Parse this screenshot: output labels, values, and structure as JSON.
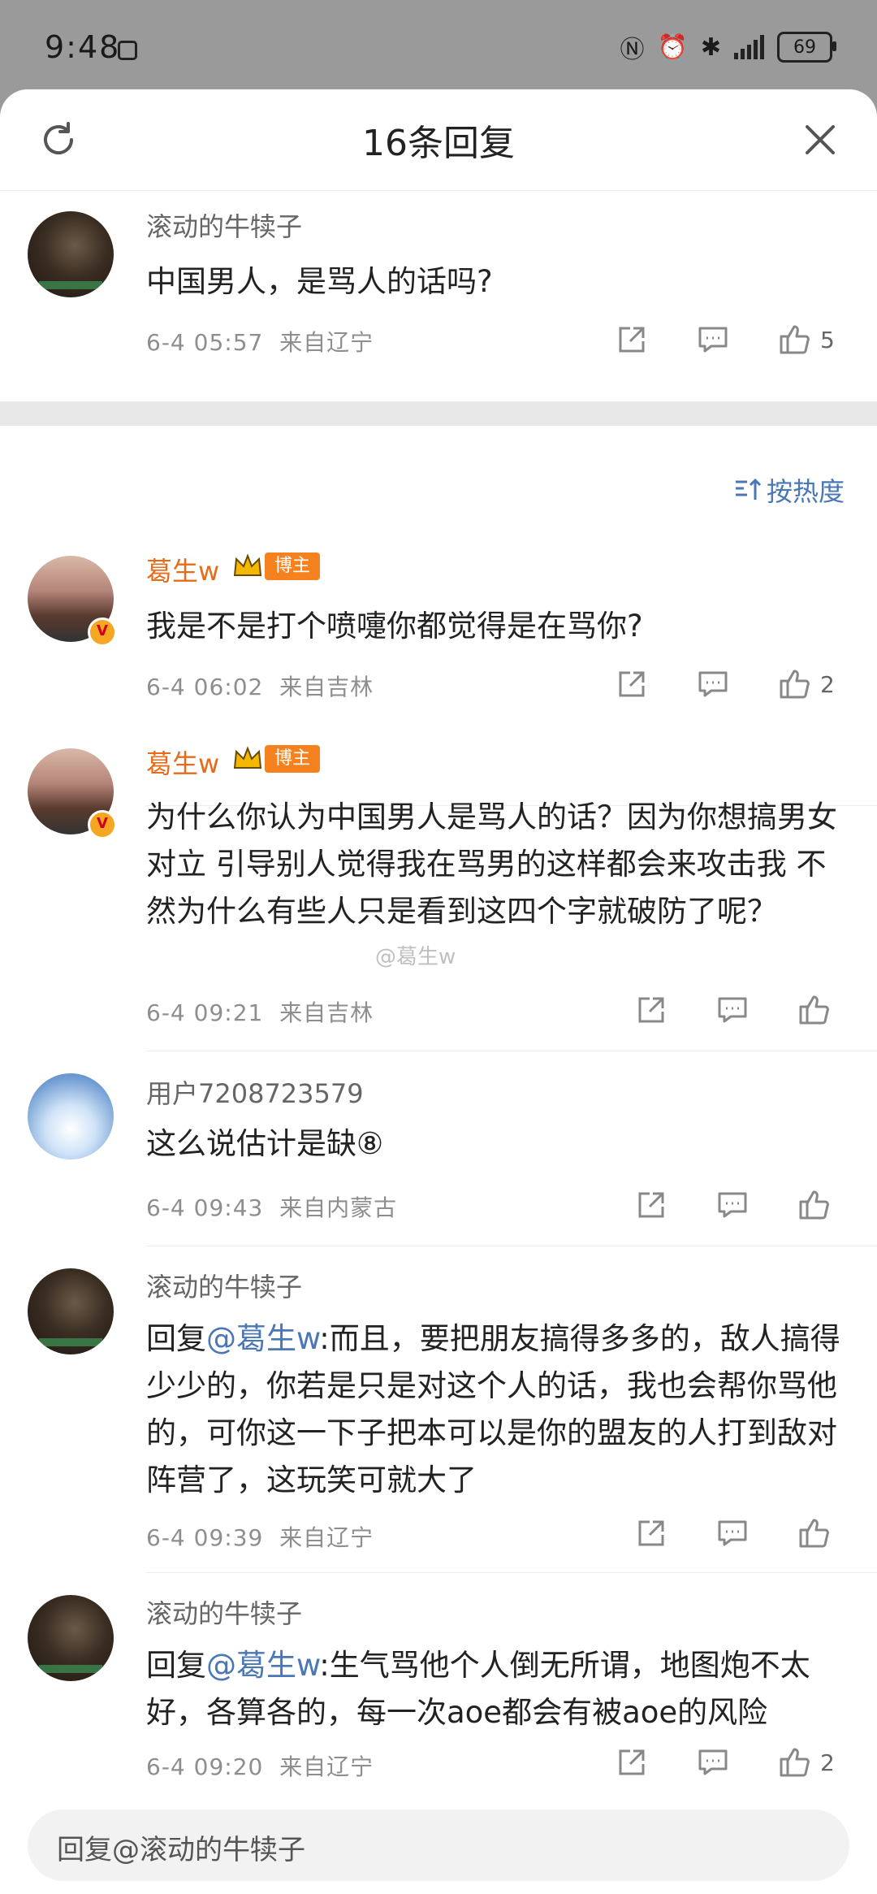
{
  "status_bar": {
    "time": "9:48",
    "battery": "69"
  },
  "header": {
    "title": "16条回复"
  },
  "sort": {
    "label": "按热度"
  },
  "root_comment": {
    "username": "滚动的牛犊子",
    "text": "中国男人，是骂人的话吗?",
    "time": "6-4 05:57",
    "location": "来自辽宁",
    "likes": "5"
  },
  "replies": [
    {
      "username": "葛生w",
      "tag": "博主",
      "text": "我是不是打个喷嚏你都觉得是在骂你?",
      "time": "6-4 06:02",
      "location": "来自吉林",
      "likes": "2"
    },
    {
      "username": "葛生w",
      "tag": "博主",
      "text": "为什么你认为中国男人是骂人的话？因为你想搞男女对立 引导别人觉得我在骂男的这样都会来攻击我 不然为什么有些人只是看到这四个字就破防了呢？",
      "watermark": "@葛生w",
      "time": "6-4 09:21",
      "location": "来自吉林",
      "likes": ""
    },
    {
      "username": "用户7208723579",
      "text": "这么说估计是缺⑧",
      "time": "6-4 09:43",
      "location": "来自内蒙古",
      "likes": ""
    },
    {
      "username": "滚动的牛犊子",
      "reply_prefix": "回复",
      "mention": "@葛生w",
      "text": ":而且，要把朋友搞得多多的，敌人搞得少少的，你若是只是对这个人的话，我也会帮你骂他的，可你这一下子把本可以是你的盟友的人打到敌对阵营了，这玩笑可就大了",
      "time": "6-4 09:39",
      "location": "来自辽宁",
      "likes": ""
    },
    {
      "username": "滚动的牛犊子",
      "reply_prefix": "回复",
      "mention": "@葛生w",
      "text": ":生气骂他个人倒无所谓，地图炮不太好，各算各的，每一次aoe都会有被aoe的风险",
      "time": "6-4 09:20",
      "location": "来自辽宁",
      "likes": "2"
    }
  ],
  "reply_input": {
    "placeholder": "回复@滚动的牛犊子"
  },
  "colors": {
    "accent_blue": "#4a77b5",
    "username_orange": "#e86b1a",
    "tag_orange": "#f6821f"
  }
}
